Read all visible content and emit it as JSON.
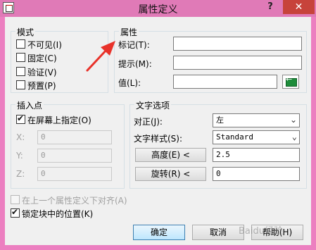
{
  "window": {
    "title": "属性定义",
    "help_glyph": "?",
    "close_glyph": "✕"
  },
  "mode": {
    "title": "模式",
    "options": [
      {
        "label": "不可见(I)",
        "checked": false
      },
      {
        "label": "固定(C)",
        "checked": false
      },
      {
        "label": "验证(V)",
        "checked": false
      },
      {
        "label": "预置(P)",
        "checked": false
      }
    ]
  },
  "attribute": {
    "title": "属性",
    "tag_label": "标记(T):",
    "tag_value": "",
    "prompt_label": "提示(M):",
    "prompt_value": "",
    "value_label": "值(L):",
    "value_value": "",
    "insert_field_icon": "insert-field-icon"
  },
  "insertion_point": {
    "title": "插入点",
    "specify_onscreen_label": "在屏幕上指定(O)",
    "specify_onscreen_checked": true,
    "x_label": "X:",
    "x_value": "0",
    "y_label": "Y:",
    "y_value": "0",
    "z_label": "Z:",
    "z_value": "0"
  },
  "text_options": {
    "title": "文字选项",
    "justify_label": "对正(J):",
    "justify_value": "左",
    "style_label": "文字样式(S):",
    "style_value": "Standard",
    "height_button": "高度(E) <",
    "height_value": "2.5",
    "rotation_button": "旋转(R) <",
    "rotation_value": "0"
  },
  "align_below_label": "在上一个属性定义下对齐(A)",
  "align_below_checked": false,
  "lock_position_label": "锁定块中的位置(K)",
  "lock_position_checked": true,
  "buttons": {
    "ok": "确定",
    "cancel": "取消",
    "help": "帮助(H)"
  },
  "watermark": "Baidu经验",
  "colors": {
    "titlebar": "#e07ab7",
    "close_button": "#c7433b",
    "annotation_arrow": "#e8322a"
  }
}
